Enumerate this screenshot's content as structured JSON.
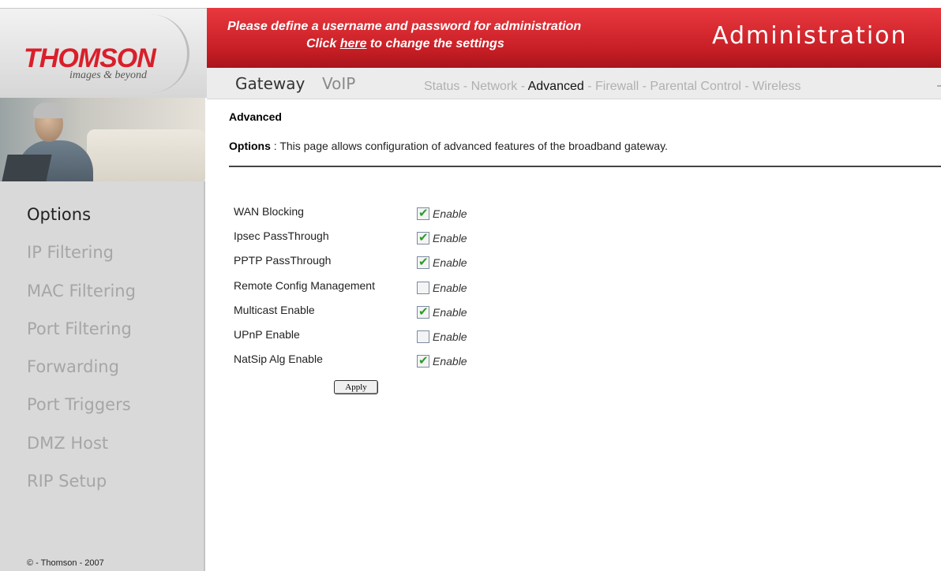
{
  "brand": {
    "logo_text": "THOMSON",
    "tagline": "images & beyond"
  },
  "banner": {
    "line1": "Please define a username and password for administration",
    "line2_pre": "Click ",
    "line2_link": "here",
    "line2_post": " to change the settings",
    "title": "Administration"
  },
  "tabs": {
    "gateway": "Gateway",
    "voip": "VoIP"
  },
  "subnav": {
    "items": [
      "Status",
      "Network",
      "Advanced",
      "Firewall",
      "Parental Control",
      "Wireless"
    ],
    "selected": "Advanced",
    "separator": "-"
  },
  "sidebar": {
    "items": [
      "Options",
      "IP Filtering",
      "MAC Filtering",
      "Port Filtering",
      "Forwarding",
      "Port Triggers",
      "DMZ Host",
      "RIP Setup"
    ],
    "active": "Options"
  },
  "footer": {
    "copyright": "© - Thomson - 2007"
  },
  "page": {
    "title": "Advanced",
    "desc_label": "Options",
    "desc_sep": " :  ",
    "desc_text": "This page allows configuration of advanced features of the broadband gateway."
  },
  "options": [
    {
      "label": "WAN Blocking",
      "checked": true,
      "enable_text": "Enable"
    },
    {
      "label": "Ipsec PassThrough",
      "checked": true,
      "enable_text": "Enable"
    },
    {
      "label": "PPTP PassThrough",
      "checked": true,
      "enable_text": "Enable"
    },
    {
      "label": "Remote Config Management",
      "checked": false,
      "enable_text": "Enable"
    },
    {
      "label": "Multicast Enable",
      "checked": true,
      "enable_text": "Enable"
    },
    {
      "label": "UPnP Enable",
      "checked": false,
      "enable_text": "Enable"
    },
    {
      "label": "NatSip Alg Enable",
      "checked": true,
      "enable_text": "Enable"
    }
  ],
  "apply_label": "Apply",
  "colors": {
    "banner_red": "#d02a31",
    "logo_red": "#d91f2a",
    "check_green": "#2a9d2a",
    "sidebar_bg": "#d9d9d9"
  }
}
